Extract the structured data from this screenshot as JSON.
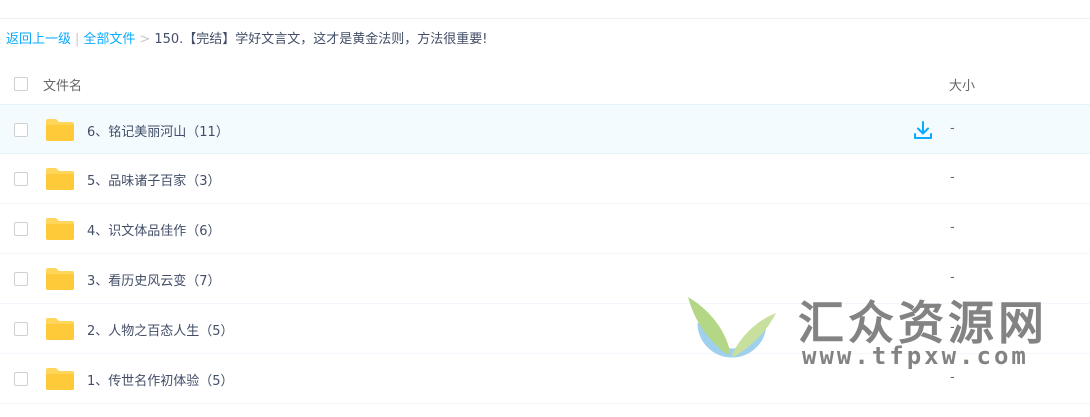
{
  "breadcrumb": {
    "back": "返回上一级",
    "sep1": "|",
    "all_files": "全部文件",
    "sep2": ">",
    "current": "150.【完结】学好文言文，这才是黄金法则，方法很重要!"
  },
  "table": {
    "header": {
      "name": "文件名",
      "size": "大小"
    },
    "rows": [
      {
        "name": "6、铭记美丽河山（11）",
        "size": "-"
      },
      {
        "name": "5、品味诸子百家（3）",
        "size": "-"
      },
      {
        "name": "4、识文体品佳作（6）",
        "size": "-"
      },
      {
        "name": "3、看历史风云变（7）",
        "size": "-"
      },
      {
        "name": "2、人物之百态人生（5）",
        "size": "-"
      },
      {
        "name": "1、传世名作初体验（5）",
        "size": "-"
      }
    ]
  },
  "watermark": {
    "title": "汇众资源网",
    "url": "www.tfpxw.com"
  },
  "colors": {
    "link": "#09aaff",
    "folder": "#ffd65a",
    "hover_row": "#f4fbff",
    "download_icon": "#09aaff"
  },
  "icons": {
    "folder": "folder-icon",
    "download": "download-icon"
  }
}
